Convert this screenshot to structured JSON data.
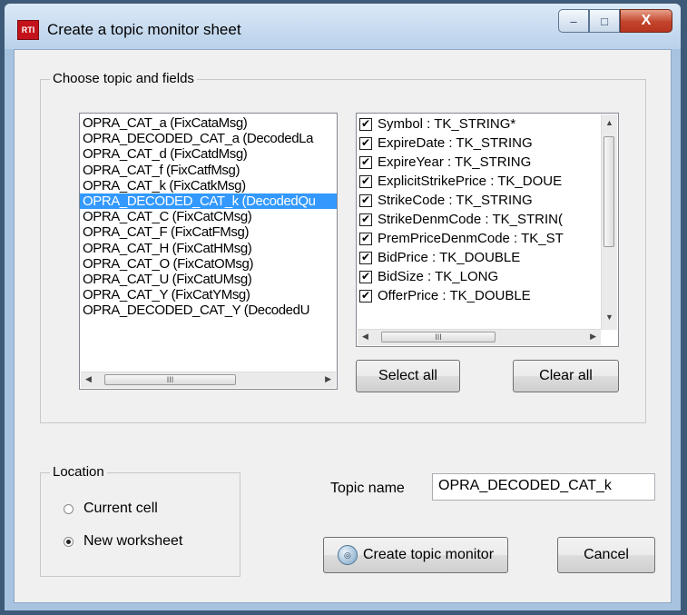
{
  "window": {
    "title": "Create a topic monitor sheet",
    "app_icon": "rti-logo-icon",
    "close_glyph": "X",
    "min_glyph": "–",
    "max_glyph": "□"
  },
  "topic_group": {
    "label": "Choose topic and fields",
    "topics": [
      "OPRA_CAT_a (FixCataMsg)",
      "OPRA_DECODED_CAT_a (DecodedLa",
      "OPRA_CAT_d (FixCatdMsg)",
      "OPRA_CAT_f (FixCatfMsg)",
      "OPRA_CAT_k (FixCatkMsg)",
      "OPRA_DECODED_CAT_k (DecodedQu",
      "OPRA_CAT_C (FixCatCMsg)",
      "OPRA_CAT_F (FixCatFMsg)",
      "OPRA_CAT_H (FixCatHMsg)",
      "OPRA_CAT_O (FixCatOMsg)",
      "OPRA_CAT_U (FixCatUMsg)",
      "OPRA_CAT_Y (FixCatYMsg)",
      "OPRA_DECODED_CAT_Y (DecodedU"
    ],
    "selected_topic_index": 5,
    "fields": [
      {
        "label": "Symbol : TK_STRING*",
        "checked": true
      },
      {
        "label": "ExpireDate : TK_STRING",
        "checked": true
      },
      {
        "label": "ExpireYear : TK_STRING",
        "checked": true
      },
      {
        "label": "ExplicitStrikePrice : TK_DOUE",
        "checked": true
      },
      {
        "label": "StrikeCode : TK_STRING",
        "checked": true
      },
      {
        "label": "StrikeDenmCode : TK_STRIN(",
        "checked": true
      },
      {
        "label": "PremPriceDenmCode : TK_ST",
        "checked": true
      },
      {
        "label": "BidPrice : TK_DOUBLE",
        "checked": true
      },
      {
        "label": "BidSize : TK_LONG",
        "checked": true
      },
      {
        "label": "OfferPrice : TK_DOUBLE",
        "checked": true
      }
    ],
    "select_all_label": "Select all",
    "clear_all_label": "Clear all",
    "thumb_glyph": "III",
    "check_glyph": "✔"
  },
  "location_group": {
    "label": "Location",
    "options": [
      {
        "label": "Current cell",
        "selected": false
      },
      {
        "label": "New worksheet",
        "selected": true
      }
    ]
  },
  "topic_name": {
    "label": "Topic name",
    "value": "OPRA_DECODED_CAT_k"
  },
  "buttons": {
    "create": "Create topic monitor",
    "cancel": "Cancel"
  },
  "colors": {
    "selection": "#3399ff",
    "window_frame": "#a7c3e0",
    "close_button": "#c2442b"
  }
}
